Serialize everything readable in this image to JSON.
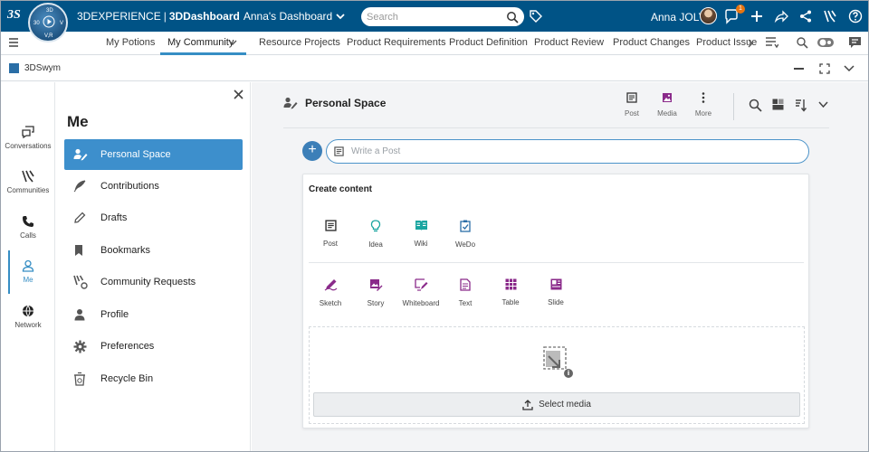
{
  "topbar": {
    "brand_prefix": "3DEXPERIENCE",
    "brand_sep": "|",
    "brand_app": "3DDashboard",
    "dashboard_name": "Anna's Dashboard",
    "search_placeholder": "Search",
    "user_name": "Anna JOLY",
    "notification_count": "1",
    "compass_labels": {
      "top": "3D",
      "left": "30",
      "right": "V",
      "bottom": "V,R"
    },
    "logo_text": "3S"
  },
  "tabs": [
    {
      "label": "My Potions"
    },
    {
      "label": "My Community"
    },
    {
      "label": "Resource Projects"
    },
    {
      "label": "Product Requirements"
    },
    {
      "label": "Product Definition"
    },
    {
      "label": "Product Review"
    },
    {
      "label": "Product Changes"
    },
    {
      "label": "Product Issue"
    }
  ],
  "appbar": {
    "title": "3DSwym"
  },
  "rail": [
    {
      "label": "Conversations"
    },
    {
      "label": "Communities"
    },
    {
      "label": "Calls"
    },
    {
      "label": "Me"
    },
    {
      "label": "Network"
    }
  ],
  "me_panel": {
    "title": "Me",
    "items": [
      {
        "label": "Personal Space"
      },
      {
        "label": "Contributions"
      },
      {
        "label": "Drafts"
      },
      {
        "label": "Bookmarks"
      },
      {
        "label": "Community Requests"
      },
      {
        "label": "Profile"
      },
      {
        "label": "Preferences"
      },
      {
        "label": "Recycle Bin"
      }
    ]
  },
  "main": {
    "header_title": "Personal Space",
    "tools": [
      {
        "label": "Post"
      },
      {
        "label": "Media"
      },
      {
        "label": "More"
      }
    ],
    "post_placeholder": "Write a Post",
    "create_content": {
      "title": "Create content",
      "row1": [
        {
          "label": "Post"
        },
        {
          "label": "Idea"
        },
        {
          "label": "Wiki"
        },
        {
          "label": "WeDo"
        }
      ],
      "row2": [
        {
          "label": "Sketch"
        },
        {
          "label": "Story"
        },
        {
          "label": "Whiteboard"
        },
        {
          "label": "Text"
        },
        {
          "label": "Table"
        },
        {
          "label": "Slide"
        }
      ],
      "select_media_label": "Select media"
    }
  },
  "colors": {
    "topbar": "#005386",
    "accent": "#368ec4",
    "active_item": "#3d8fcc",
    "purple_icon": "#8a2a8a",
    "teal_icon": "#1aa5a0",
    "blue_icon": "#2b6ea8"
  }
}
